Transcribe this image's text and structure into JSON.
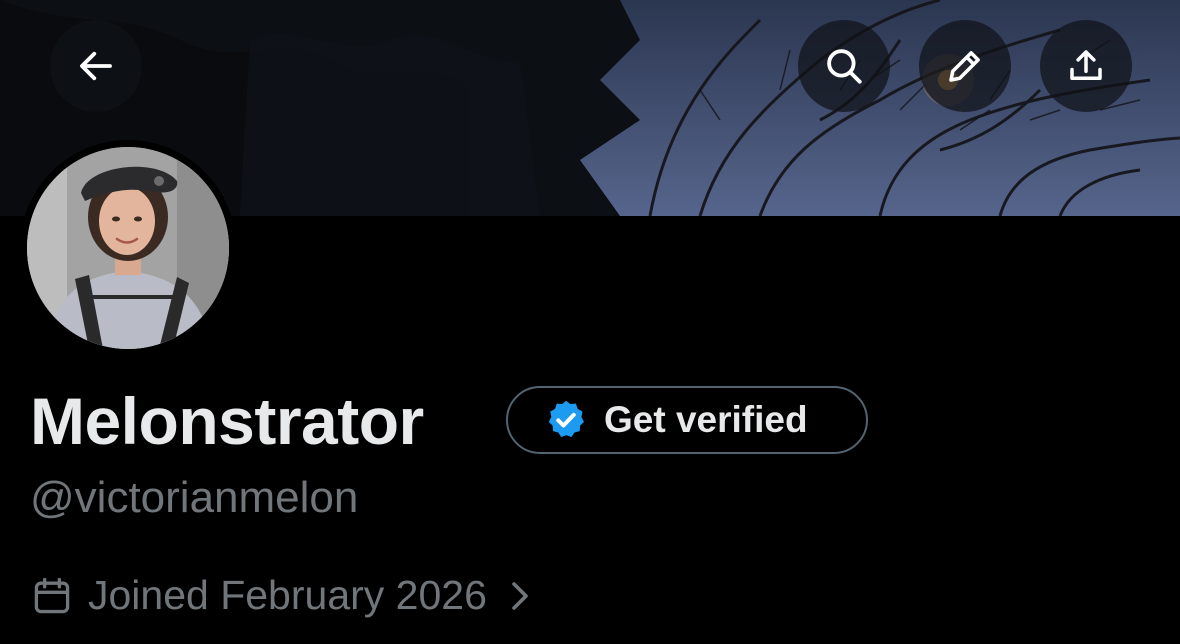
{
  "header": {
    "icons": {
      "back": "arrow-left-icon",
      "search": "search-icon",
      "edit": "pencil-icon",
      "share": "share-icon"
    }
  },
  "profile": {
    "display_name": "Melonstrator",
    "handle": "@victorianmelon",
    "get_verified_label": "Get verified",
    "joined_text": "Joined February 2026"
  },
  "colors": {
    "background": "#000000",
    "primary_text": "#e7e9ea",
    "secondary_text": "#71767b",
    "verified_blue": "#1d9bf0",
    "pill_border": "#536471"
  }
}
